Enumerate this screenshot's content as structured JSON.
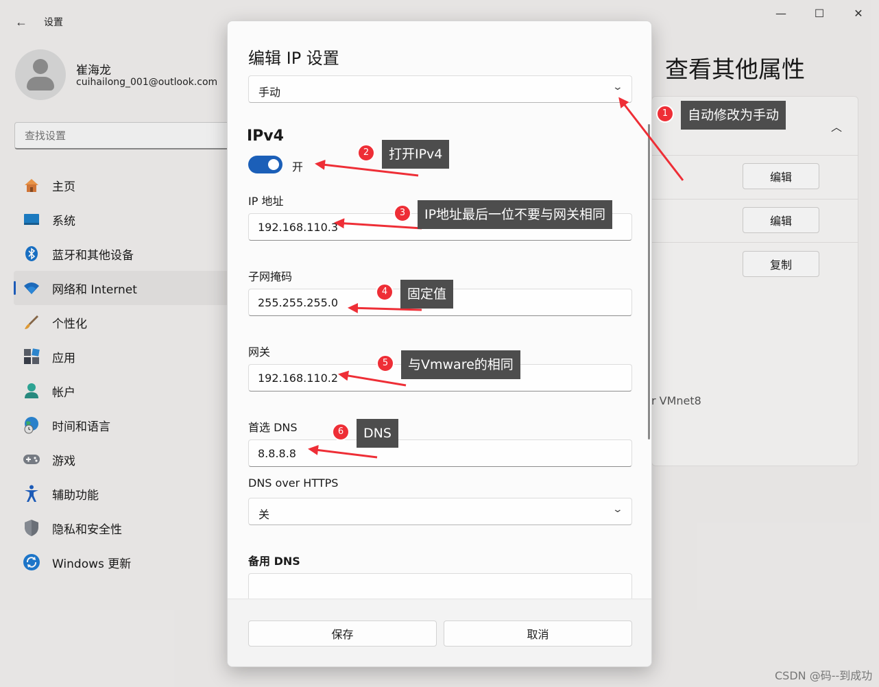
{
  "window": {
    "back_icon": "back-arrow-icon",
    "title": "设置",
    "minimize_glyph": "—",
    "maximize_glyph": "☐",
    "close_glyph": "✕"
  },
  "profile": {
    "name": "崔海龙",
    "email": "cuihailong_001@outlook.com"
  },
  "search": {
    "placeholder": "查找设置"
  },
  "sidebar": {
    "items": [
      {
        "label": "主页",
        "icon": "home-icon"
      },
      {
        "label": "系统",
        "icon": "monitor-icon"
      },
      {
        "label": "蓝牙和其他设备",
        "icon": "bluetooth-icon"
      },
      {
        "label": "网络和 Internet",
        "icon": "wifi-icon",
        "active": true
      },
      {
        "label": "个性化",
        "icon": "brush-icon"
      },
      {
        "label": "应用",
        "icon": "apps-icon"
      },
      {
        "label": "帐户",
        "icon": "account-icon"
      },
      {
        "label": "时间和语言",
        "icon": "globe-clock-icon"
      },
      {
        "label": "游戏",
        "icon": "gamepad-icon"
      },
      {
        "label": "辅助功能",
        "icon": "accessibility-icon"
      },
      {
        "label": "隐私和安全性",
        "icon": "shield-icon"
      },
      {
        "label": "Windows 更新",
        "icon": "update-icon"
      }
    ]
  },
  "right_panel": {
    "title": "查看其他属性",
    "edit_button_1": "编辑",
    "edit_button_2": "编辑",
    "copy_button": "复制",
    "vmnet_text": "r VMnet8"
  },
  "dialog": {
    "title": "编辑 IP 设置",
    "mode_select": "手动",
    "section_ipv4": "IPv4",
    "ipv4_toggle_label": "开",
    "ipv4_enabled": true,
    "ip_label": "IP 地址",
    "ip_value": "192.168.110.3",
    "subnet_label": "子网掩码",
    "subnet_value": "255.255.255.0",
    "gateway_label": "网关",
    "gateway_value": "192.168.110.2",
    "dns_label": "首选 DNS",
    "dns_value": "8.8.8.8",
    "dns_https_label": "DNS over HTTPS",
    "dns_https_select": "关",
    "alt_dns_label": "备用 DNS",
    "save_button": "保存",
    "cancel_button": "取消"
  },
  "annotations": [
    {
      "number": "1",
      "text": "自动修改为手动"
    },
    {
      "number": "2",
      "text": "打开IPv4"
    },
    {
      "number": "3",
      "text": "IP地址最后一位不要与网关相同"
    },
    {
      "number": "4",
      "text": "固定值"
    },
    {
      "number": "5",
      "text": "与Vmware的相同"
    },
    {
      "number": "6",
      "text": "DNS"
    }
  ],
  "watermark": "CSDN @码--到成功",
  "colors": {
    "accent": "#1b5fb8",
    "annotation_red": "#ee2e36",
    "callout_bg": "#4d4d4d"
  }
}
